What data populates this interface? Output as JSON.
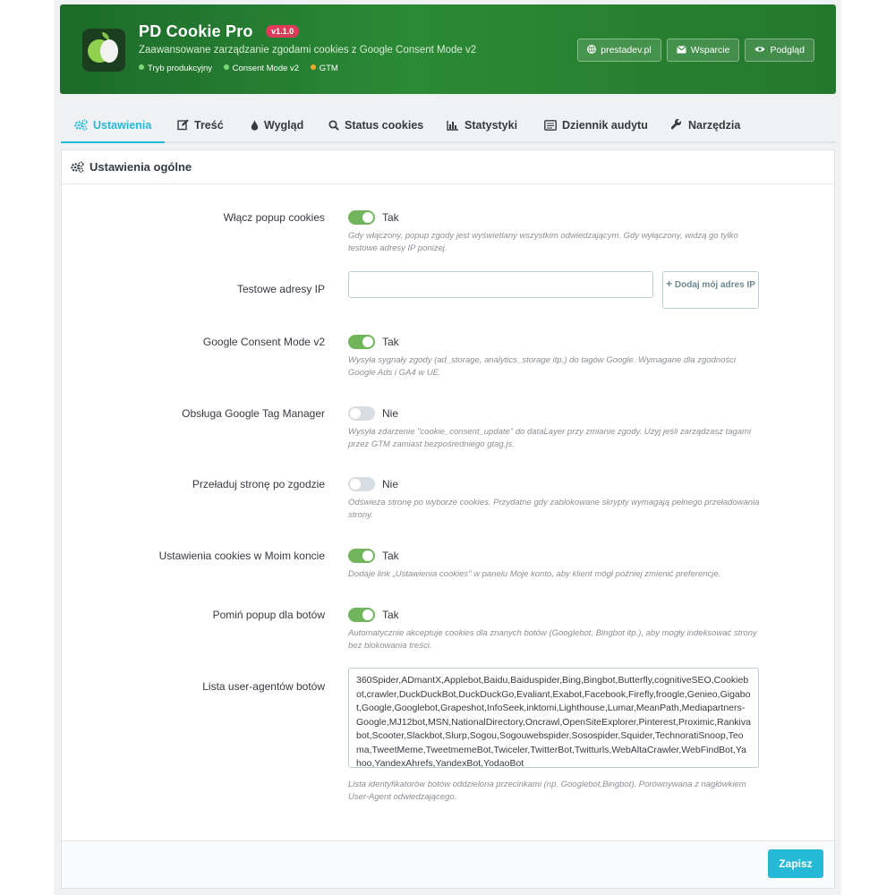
{
  "header": {
    "title": "PD Cookie Pro",
    "version": "v1.1.0",
    "subtitle": "Zaawansowane zarządzanie zgodami cookies z Google Consent Mode v2",
    "statuses": [
      {
        "label": "Tryb produkcyjny",
        "color": "#7ed67a"
      },
      {
        "label": "Consent Mode v2",
        "color": "#7ed67a"
      },
      {
        "label": "GTM",
        "color": "#f5a623"
      }
    ],
    "buttons": [
      {
        "label": "prestadev.pl",
        "icon": "globe-icon"
      },
      {
        "label": "Wsparcie",
        "icon": "envelope-icon"
      },
      {
        "label": "Podgląd",
        "icon": "eye-icon"
      }
    ]
  },
  "tabs": [
    {
      "label": "Ustawienia",
      "icon": "gears-icon",
      "active": true
    },
    {
      "label": "Treść",
      "icon": "edit-icon"
    },
    {
      "label": "Wygląd",
      "icon": "tint-icon"
    },
    {
      "label": "Status cookies",
      "icon": "search-icon"
    },
    {
      "label": "Statystyki",
      "icon": "bar-chart-icon"
    },
    {
      "label": "Dziennik audytu",
      "icon": "log-icon"
    },
    {
      "label": "Narzędzia",
      "icon": "wrench-icon"
    }
  ],
  "panel": {
    "title": "Ustawienia ogólne",
    "save_label": "Zapisz"
  },
  "form": {
    "enable_popup": {
      "label": "Włącz popup cookies",
      "value": "Tak",
      "help": "Gdy włączony, popup zgody jest wyświetlany wszystkim odwiedzającym. Gdy wyłączony, widzą go tylko testowe adresy IP poniżej."
    },
    "test_ips": {
      "label": "Testowe adresy IP",
      "value": "",
      "button_label": "Dodaj mój adres IP"
    },
    "consent_mode": {
      "label": "Google Consent Mode v2",
      "value": "Tak",
      "help": "Wysyła sygnały zgody (ad_storage, analytics_storage itp.) do tagów Google. Wymagane dla zgodności Google Ads i GA4 w UE."
    },
    "gtm": {
      "label": "Obsługa Google Tag Manager",
      "value": "Nie",
      "help": "Wysyła zdarzenie \"cookie_consent_update\" do dataLayer przy zmianie zgody. Użyj jeśli zarządzasz tagami przez GTM zamiast bezpośredniego gtag.js."
    },
    "reload": {
      "label": "Przeładuj stronę po zgodzie",
      "value": "Nie",
      "help": "Odświeża stronę po wyborze cookies. Przydatne gdy zablokowane skrypty wymagają pełnego przeładowania strony."
    },
    "account_settings": {
      "label": "Ustawienia cookies w Moim koncie",
      "value": "Tak",
      "help": "Dodaje link „Ustawienia cookies\" w panelu Moje konto, aby klient mógł później zmienić preferencje."
    },
    "skip_bots": {
      "label": "Pomiń popup dla botów",
      "value": "Tak",
      "help": "Automatycznie akceptuje cookies dla znanych botów (Googlebot, Bingbot itp.), aby mogły indeksować strony bez blokowania treści."
    },
    "bot_agents": {
      "label": "Lista user-agentów botów",
      "value": "360Spider,ADmantX,Applebot,Baidu,Baiduspider,Bing,Bingbot,Butterfly,cognitiveSEO,Cookiebot,crawler,DuckDuckBot,DuckDuckGo,Evaliant,Exabot,Facebook,Firefly,froogle,Genieo,Gigabot,Google,Googlebot,Grapeshot,InfoSeek,inktomi,Lighthouse,Lumar,MeanPath,Mediapartners-Google,MJ12bot,MSN,NationalDirectory,Oncrawl,OpenSiteExplorer,Pinterest,Proximic,Rankivabot,Scooter,Slackbot,Slurp,Sogou,Sogouwebspider,Sosospider,Squider,TechnoratiSnoop,Teoma,TweetMeme,TweetmemeBot,Twiceler,TwitterBot,Twitturls,WebAltaCrawler,WebFindBot,Yahoo,YandexAhrefs,YandexBot,YodaoBot",
      "help": "Lista identyfikatorów botów oddzielona przecinkami (np. Googlebot,Bingbot). Porównywana z nagłówkiem User-Agent odwiedzającego."
    }
  }
}
